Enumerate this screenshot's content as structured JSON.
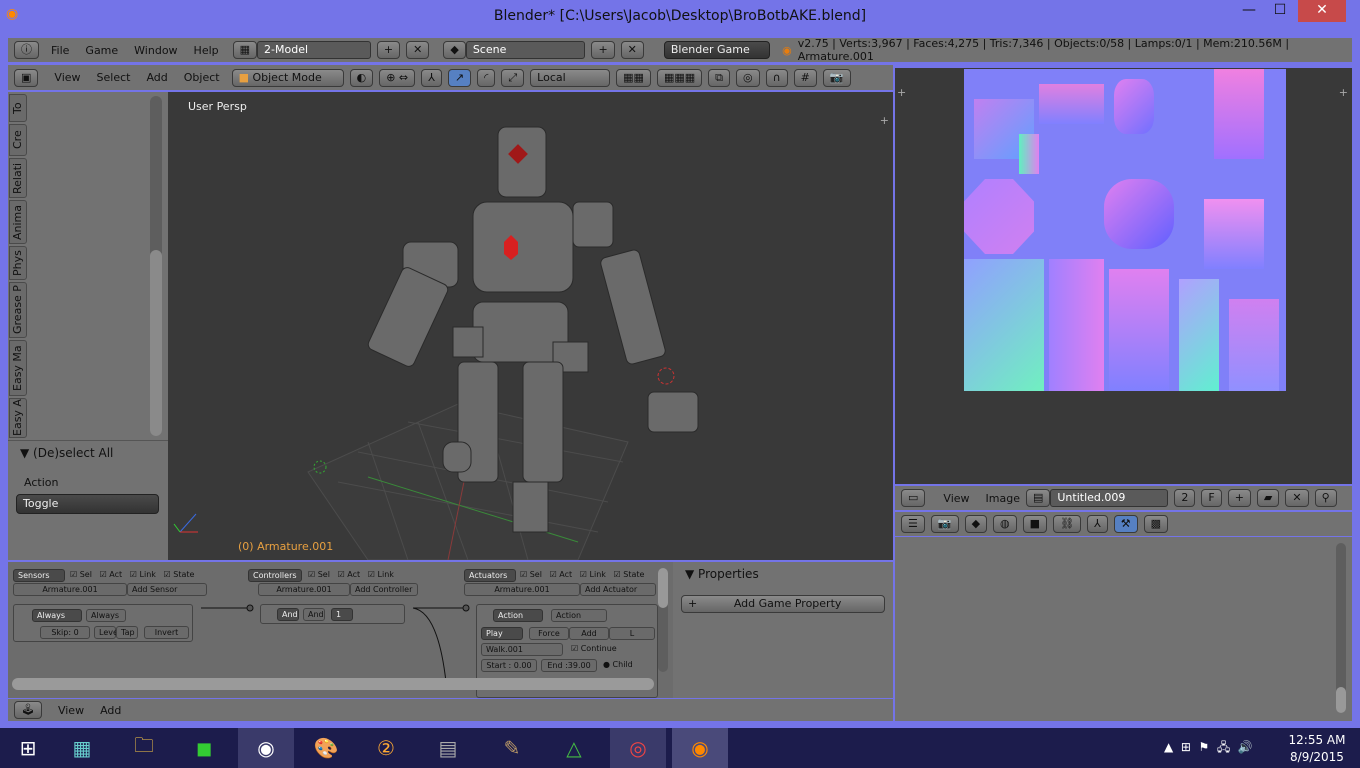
{
  "window": {
    "title": "Blender* [C:\\Users\\Jacob\\Desktop\\BroBotbAKE.blend]",
    "minimize": "—",
    "maximize": "☐",
    "close": "✕"
  },
  "info": {
    "menus": [
      "File",
      "Game",
      "Window",
      "Help"
    ],
    "screen": "2-Model",
    "scene": "Scene",
    "engine": "Blender Game",
    "stats": "v2.75 | Verts:3,967 | Faces:4,275 | Tris:7,346 | Objects:0/58 | Lamps:0/1 | Mem:210.56M | Armature.001"
  },
  "view3d": {
    "menus": [
      "View",
      "Select",
      "Add",
      "Object"
    ],
    "mode": "Object Mode",
    "orientation": "Local",
    "label": "User Persp",
    "object_label": "(0) Armature.001"
  },
  "toolshelf": {
    "tabs": [
      "To",
      "Cre",
      "Relati",
      "Anima",
      "Phys",
      "Grease P",
      "Easy Ma",
      "Easy A"
    ],
    "operator": "▼ (De)select All",
    "action_label": "Action",
    "action_value": "Toggle"
  },
  "image_editor": {
    "menus": [
      "View",
      "Image"
    ],
    "image_name": "Untitled.009",
    "users": "2",
    "fake": "F"
  },
  "properties": {
    "title": "Properties",
    "add_button": "Add Game Property"
  },
  "logic": {
    "sensors": {
      "label": "Sensors",
      "object": "Armature.001",
      "add": "Add Sensor",
      "type": "Always",
      "name": "Always",
      "skip": "Skip:  0",
      "level": "Level",
      "tap": "Tap",
      "invert": "Invert"
    },
    "controllers": {
      "label": "Controllers",
      "object": "Armature.001",
      "add": "Add Controller",
      "type": "And",
      "name": "And",
      "state": "1"
    },
    "actuators": {
      "label": "Actuators",
      "object": "Armature.001",
      "add": "Add Actuator",
      "type": "Action",
      "name": "Action",
      "play": "Play",
      "force": "Force",
      "add_btn": "Add",
      "l": "L",
      "action": "Walk.001",
      "continue": "Continue",
      "start": "Start : 0.00",
      "end": "End :39.00",
      "child": "Child"
    },
    "filters": [
      "Sel",
      "Act",
      "Link",
      "State"
    ],
    "menus": [
      "View",
      "Add"
    ]
  },
  "taskbar": {
    "time": "12:55 AM",
    "date": "8/9/2015"
  },
  "colors": {
    "frame": "#7474e8",
    "viewport": "#393939",
    "panel": "#727272",
    "taskbar": "#1c1c4c"
  }
}
